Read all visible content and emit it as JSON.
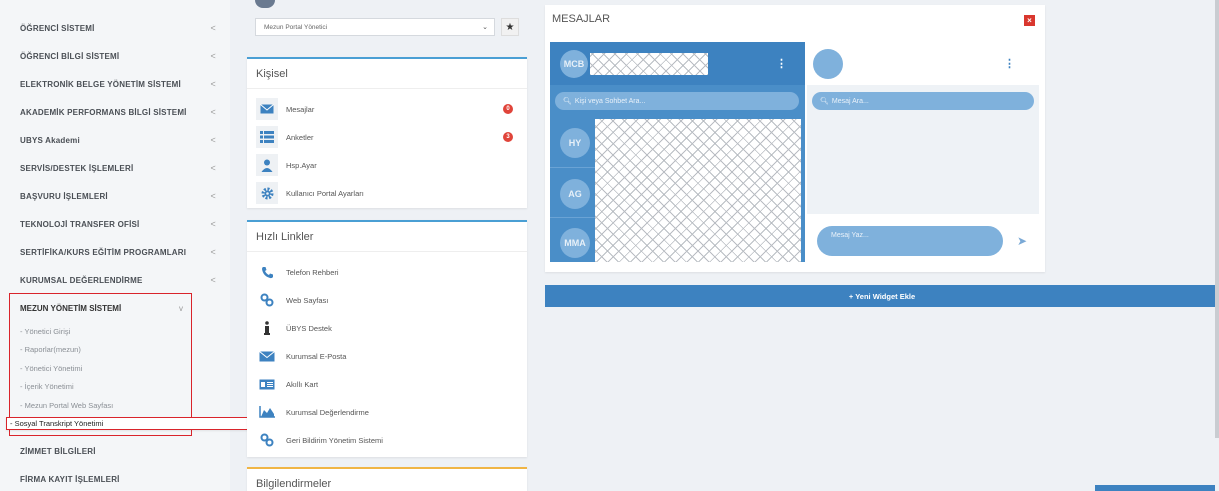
{
  "sidebar": {
    "items": [
      {
        "label": "ÖĞRENCİ SİSTEMİ"
      },
      {
        "label": "ÖĞRENCİ BİLGİ SİSTEMİ"
      },
      {
        "label": "ELEKTRONİK BELGE YÖNETİM SİSTEMİ"
      },
      {
        "label": "AKADEMİK PERFORMANS BİLGİ SİSTEMİ"
      },
      {
        "label": "UBYS Akademi"
      },
      {
        "label": "SERVİS/DESTEK İŞLEMLERİ"
      },
      {
        "label": "BAŞVURU İŞLEMLERİ"
      },
      {
        "label": "TEKNOLOJİ TRANSFER OFİSİ"
      },
      {
        "label": "SERTİFİKA/KURS EĞİTİM PROGRAMLARI"
      },
      {
        "label": "KURUMSAL DEĞERLENDİRME"
      }
    ],
    "chevron": "<",
    "group": {
      "label": "MEZUN YÖNETİM SİSTEMİ",
      "chevron": "v",
      "subitems": [
        {
          "label": "- Yönetici Girişi"
        },
        {
          "label": "- Raporlar(mezun)"
        },
        {
          "label": "- Yönetici Yönetimi"
        },
        {
          "label": "- İçerik Yönetimi"
        },
        {
          "label": "- Mezun Portal Web Sayfası"
        },
        {
          "label": "- Sosyal Transkript Yönetimi"
        }
      ]
    },
    "after": [
      {
        "label": "ZİMMET BİLGİLERİ"
      },
      {
        "label": "FİRMA KAYIT İŞLEMLERİ"
      }
    ]
  },
  "middle": {
    "select_value": "Mezun Portal Yönetici",
    "kisisel": {
      "title": "Kişisel",
      "items": [
        {
          "label": "Mesajlar",
          "badge": "0",
          "icon": "envelope-icon"
        },
        {
          "label": "Anketler",
          "badge": "3",
          "icon": "list-icon"
        },
        {
          "label": "Hsp.Ayar",
          "icon": "user-icon"
        },
        {
          "label": "Kullanıcı Portal Ayarları",
          "icon": "gear-icon"
        }
      ]
    },
    "hizli": {
      "title": "Hızlı Linkler",
      "items": [
        {
          "label": "Telefon Rehberi",
          "icon": "phone-icon"
        },
        {
          "label": "Web Sayfası",
          "icon": "link-icon"
        },
        {
          "label": "ÜBYS Destek",
          "icon": "info-icon"
        },
        {
          "label": "Kurumsal E-Posta",
          "icon": "envelope-icon"
        },
        {
          "label": "Akıllı Kart",
          "icon": "card-icon"
        },
        {
          "label": "Kurumsal Değerlendirme",
          "icon": "chart-icon"
        },
        {
          "label": "Geri Bildirim Yönetim Sistemi",
          "icon": "link-icon"
        }
      ]
    },
    "bilgi": {
      "title": "Bilgilendirmeler"
    }
  },
  "messages": {
    "title": "MESAJLAR",
    "close": "×",
    "current_user": "MCB",
    "search_contacts": "Kişi veya Sohbet Ara...",
    "search_messages": "Mesaj Ara...",
    "contacts": [
      {
        "initials": "HY"
      },
      {
        "initials": "AG"
      },
      {
        "initials": "MMA"
      }
    ],
    "write_placeholder": "Mesaj Yaz...",
    "dots": "⋮"
  },
  "widget": {
    "label": "+ Yeni Widget Ekle"
  },
  "colors": {
    "accent": "#3d82c0",
    "alert": "#d9242b",
    "panel_blue": "#4a8ec8"
  }
}
